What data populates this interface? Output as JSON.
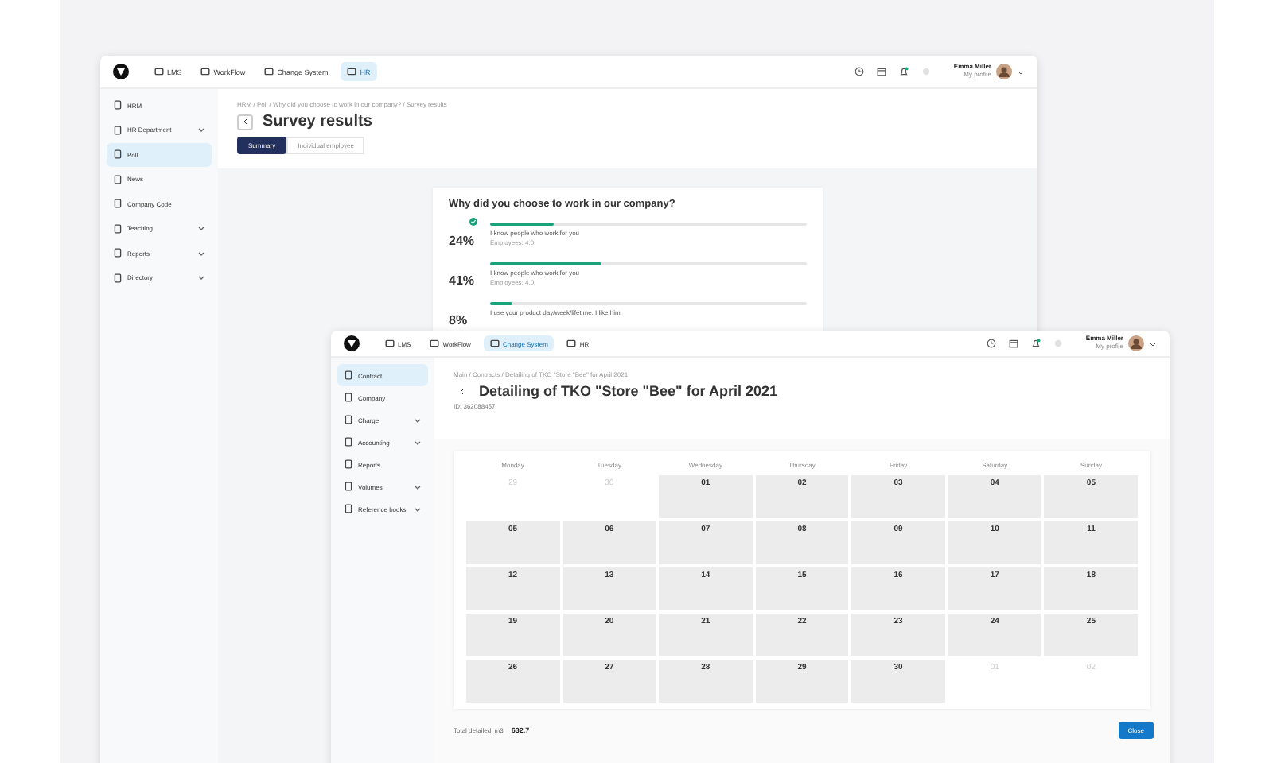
{
  "windows": [
    {
      "kind": "survey",
      "nav": [
        {
          "label": "LMS",
          "selected": false
        },
        {
          "label": "WorkFlow",
          "selected": false
        },
        {
          "label": "Change System",
          "selected": false
        },
        {
          "label": "HR",
          "selected": true
        }
      ],
      "user": {
        "name": "Emma Miller",
        "link": "My profile"
      },
      "sidebar": [
        {
          "label": "HRM",
          "selected": false,
          "expandable": false
        },
        {
          "label": "HR Department",
          "selected": false,
          "expandable": true
        },
        {
          "label": "Poll",
          "selected": true,
          "expandable": false
        },
        {
          "label": "News",
          "selected": false,
          "expandable": false
        },
        {
          "label": "Company Code",
          "selected": false,
          "expandable": false
        },
        {
          "label": "Teaching",
          "selected": false,
          "expandable": true
        },
        {
          "label": "Reports",
          "selected": false,
          "expandable": true
        },
        {
          "label": "Directory",
          "selected": false,
          "expandable": true
        }
      ],
      "breadcrumb": "HRM / Poll / Why did you choose to work in our company? / Survey results",
      "title": "Survey results",
      "tabs": [
        {
          "label": "Summary",
          "selected": true
        },
        {
          "label": "Individual employee",
          "selected": false
        }
      ],
      "poll": {
        "question": "Why did you choose to work in our company?",
        "options": [
          {
            "percent": "24%",
            "level": 0.2,
            "checked": true,
            "text": "I know people who work for you",
            "sub": "Employees: 4.0"
          },
          {
            "percent": "41%",
            "level": 0.35,
            "checked": false,
            "text": "I know people who work for you",
            "sub": "Employees: 4.0"
          },
          {
            "percent": "8%",
            "level": 0.07,
            "checked": false,
            "text": "I use your product day/week/lifetime. I like him"
          }
        ]
      }
    },
    {
      "kind": "calendar",
      "nav": [
        {
          "label": "LMS",
          "selected": false
        },
        {
          "label": "WorkFlow",
          "selected": false
        },
        {
          "label": "Change System",
          "selected": true
        },
        {
          "label": "HR",
          "selected": false
        }
      ],
      "user": {
        "name": "Emma Miller",
        "link": "My profile"
      },
      "sidebar": [
        {
          "label": "Contract",
          "selected": true,
          "expandable": false
        },
        {
          "label": "Company",
          "selected": false,
          "expandable": false
        },
        {
          "label": "Charge",
          "selected": false,
          "expandable": true
        },
        {
          "label": "Accounting",
          "selected": false,
          "expandable": true
        },
        {
          "label": "Reports",
          "selected": false,
          "expandable": false
        },
        {
          "label": "Volumes",
          "selected": false,
          "expandable": true
        },
        {
          "label": "Reference books",
          "selected": false,
          "expandable": true
        }
      ],
      "breadcrumb": "Main / Contracts / Detailing of TKO \"Store \"Bee\" for April 2021",
      "title": "Detailing of TKO \"Store \"Bee\" for April 2021",
      "id_line": "ID: 362088457",
      "weekdays": [
        "Monday",
        "Tuesday",
        "Wednesday",
        "Thursday",
        "Friday",
        "Saturday",
        "Sunday"
      ],
      "days": [
        {
          "label": "29",
          "muted": true
        },
        {
          "label": "30",
          "muted": true
        },
        {
          "label": "01",
          "muted": false
        },
        {
          "label": "02",
          "muted": false
        },
        {
          "label": "03",
          "muted": false
        },
        {
          "label": "04",
          "muted": false
        },
        {
          "label": "05",
          "muted": false
        },
        {
          "label": "05",
          "muted": false
        },
        {
          "label": "06",
          "muted": false
        },
        {
          "label": "07",
          "muted": false
        },
        {
          "label": "08",
          "muted": false
        },
        {
          "label": "09",
          "muted": false
        },
        {
          "label": "10",
          "muted": false
        },
        {
          "label": "11",
          "muted": false
        },
        {
          "label": "12",
          "muted": false
        },
        {
          "label": "13",
          "muted": false
        },
        {
          "label": "14",
          "muted": false
        },
        {
          "label": "15",
          "muted": false
        },
        {
          "label": "16",
          "muted": false
        },
        {
          "label": "17",
          "muted": false
        },
        {
          "label": "18",
          "muted": false
        },
        {
          "label": "19",
          "muted": false
        },
        {
          "label": "20",
          "muted": false
        },
        {
          "label": "21",
          "muted": false
        },
        {
          "label": "22",
          "muted": false
        },
        {
          "label": "23",
          "muted": false
        },
        {
          "label": "24",
          "muted": false
        },
        {
          "label": "25",
          "muted": false
        },
        {
          "label": "26",
          "muted": false
        },
        {
          "label": "27",
          "muted": false
        },
        {
          "label": "28",
          "muted": false
        },
        {
          "label": "29",
          "muted": false
        },
        {
          "label": "30",
          "muted": false
        },
        {
          "label": "01",
          "muted": true
        },
        {
          "label": "02",
          "muted": true
        }
      ],
      "footer": {
        "total_label": "Total detailed, m3",
        "total": "632.7",
        "button": "Close"
      }
    }
  ]
}
